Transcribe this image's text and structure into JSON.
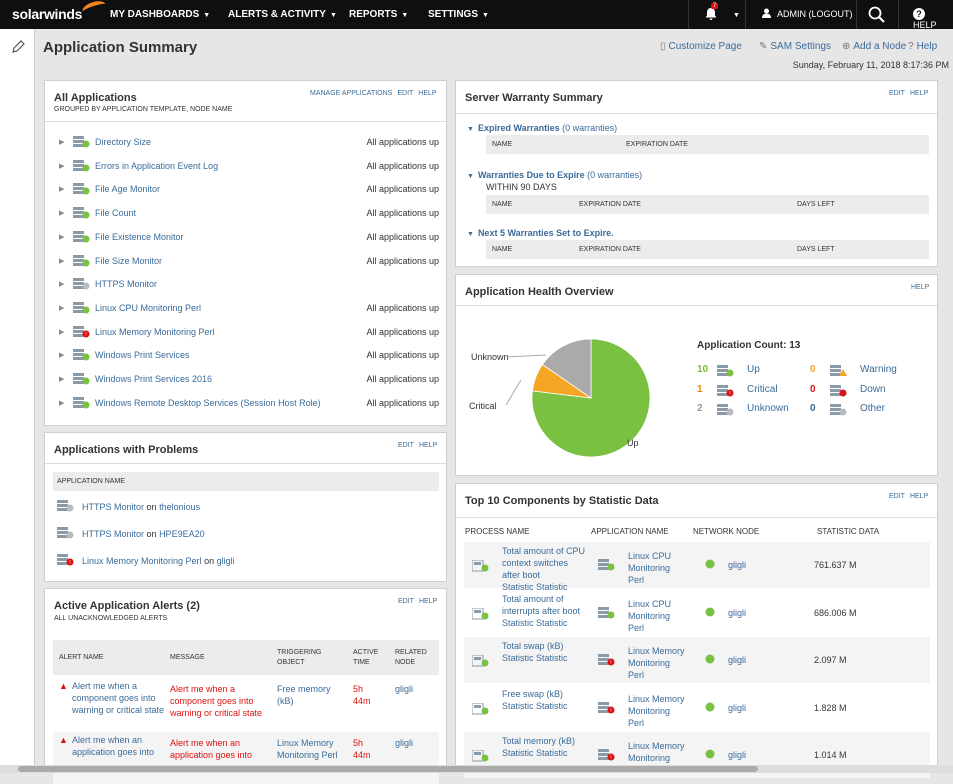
{
  "brand": "solarwinds",
  "nav": {
    "items": [
      "MY DASHBOARDS",
      "ALERTS & ACTIVITY",
      "REPORTS",
      "SETTINGS"
    ],
    "alert_count": "7",
    "user": "ADMIN (LOGOUT)",
    "help": "HELP"
  },
  "page": {
    "title": "Application Summary",
    "links": [
      "Customize Page",
      "SAM Settings",
      "Add a Node",
      "Help"
    ],
    "timestamp": "Sunday, February 11, 2018 8:17:36 PM"
  },
  "all_apps": {
    "title": "All Applications",
    "subtitle": "GROUPED BY APPLICATION TEMPLATE, NODE NAME",
    "links": [
      "MANAGE APPLICATIONS",
      "EDIT",
      "HELP"
    ],
    "rows": [
      {
        "name": "Directory Size",
        "status": "All applications up",
        "icon": "up"
      },
      {
        "name": "Errors in Application Event Log",
        "status": "All applications up",
        "icon": "up"
      },
      {
        "name": "File Age Monitor",
        "status": "All applications up",
        "icon": "up"
      },
      {
        "name": "File Count",
        "status": "All applications up",
        "icon": "up"
      },
      {
        "name": "File Existence Monitor",
        "status": "All applications up",
        "icon": "up"
      },
      {
        "name": "File Size Monitor",
        "status": "All applications up",
        "icon": "up"
      },
      {
        "name": "HTTPS Monitor",
        "status": "",
        "icon": "unknown"
      },
      {
        "name": "Linux CPU Monitoring Perl",
        "status": "All applications up",
        "icon": "up"
      },
      {
        "name": "Linux Memory Monitoring Perl",
        "status": "All applications up",
        "icon": "critical"
      },
      {
        "name": "Windows Print Services",
        "status": "All applications up",
        "icon": "up"
      },
      {
        "name": "Windows Print Services 2016",
        "status": "All applications up",
        "icon": "up"
      },
      {
        "name": "Windows Remote Desktop Services (Session Host Role)",
        "status": "All applications up",
        "icon": "up"
      }
    ]
  },
  "problems": {
    "title": "Applications with Problems",
    "links": [
      "EDIT",
      "HELP"
    ],
    "col": "APPLICATION NAME",
    "rows": [
      {
        "app": "HTTPS Monitor",
        "on": "on",
        "node": "thelonious",
        "icon": "unknown"
      },
      {
        "app": "HTTPS Monitor",
        "on": "on",
        "node": "HPE9EA20",
        "icon": "unknown"
      },
      {
        "app": "Linux Memory Monitoring Perl",
        "on": "on",
        "node": "gligli",
        "icon": "critical"
      }
    ]
  },
  "alerts": {
    "title": "Active Application Alerts (2)",
    "subtitle": "ALL UNACKNOWLEDGED ALERTS",
    "links": [
      "EDIT",
      "HELP"
    ],
    "cols": [
      "ALERT NAME",
      "MESSAGE",
      "TRIGGERING OBJECT",
      "ACTIVE TIME",
      "RELATED NODE"
    ],
    "rows": [
      {
        "name": "Alert me when a component goes into warning or critical state",
        "message": "Alert me when a component goes into warning or critical state",
        "object": "Free memory (kB)",
        "time": "5h 44m",
        "node": "gligli"
      },
      {
        "name": "Alert me when an application goes into",
        "message": "Alert me when an application goes into",
        "object": "Linux Memory Monitoring Perl",
        "time": "5h 44m",
        "node": "gligli"
      }
    ]
  },
  "warranty": {
    "title": "Server Warranty Summary",
    "links": [
      "EDIT",
      "HELP"
    ],
    "expired": {
      "label": "Expired Warranties",
      "count": "(0 warranties)",
      "cols": [
        "NAME",
        "EXPIRATION DATE"
      ]
    },
    "due": {
      "label": "Warranties Due to Expire",
      "count": "(0 warranties)",
      "within": "WITHIN 90 DAYS",
      "cols": [
        "NAME",
        "EXPIRATION DATE",
        "DAYS LEFT"
      ]
    },
    "next": {
      "label": "Next 5 Warranties Set to Expire.",
      "cols": [
        "NAME",
        "EXPIRATION DATE",
        "DAYS LEFT"
      ]
    }
  },
  "health": {
    "title": "Application Health Overview",
    "links": [
      "HELP"
    ],
    "count_label": "Application Count: 13",
    "legend": [
      {
        "count": "10",
        "label": "Up",
        "color": "#7abd30"
      },
      {
        "count": "0",
        "label": "Warning",
        "color": "#f5a623"
      },
      {
        "count": "1",
        "label": "Critical",
        "color": "#e8821a"
      },
      {
        "count": "0",
        "label": "Down",
        "color": "#d11"
      },
      {
        "count": "2",
        "label": "Unknown",
        "color": "#999"
      },
      {
        "count": "0",
        "label": "Other",
        "color": "#3a6b9a"
      }
    ],
    "pie_labels": {
      "unknown": "Unknown",
      "critical": "Critical",
      "up": "Up"
    }
  },
  "chart_data": {
    "type": "pie",
    "categories": [
      "Up",
      "Critical",
      "Unknown"
    ],
    "values": [
      10,
      1,
      2
    ],
    "colors": [
      "#7ac142",
      "#f5a623",
      "#aaaaaa"
    ]
  },
  "top10": {
    "title": "Top 10 Components by Statistic Data",
    "links": [
      "EDIT",
      "HELP"
    ],
    "cols": [
      "PROCESS NAME",
      "APPLICATION NAME",
      "NETWORK NODE",
      "STATISTIC DATA"
    ],
    "rows": [
      {
        "process": "Total amount of CPU context switches after boot",
        "stat_label": "Statistic Statistic",
        "app": "Linux CPU Monitoring Perl",
        "node": "gligli",
        "value": "761.637 M",
        "icon": "up"
      },
      {
        "process": "Total amount of interrupts after boot",
        "stat_label": "Statistic Statistic",
        "app": "Linux CPU Monitoring Perl",
        "node": "gligli",
        "value": "686.006 M",
        "icon": "up"
      },
      {
        "process": "Total swap (kB)",
        "stat_label": "Statistic Statistic",
        "app": "Linux Memory Monitoring Perl",
        "node": "gligli",
        "value": "2.097 M",
        "icon": "critical"
      },
      {
        "process": "Free swap (kB)",
        "stat_label": "Statistic Statistic",
        "app": "Linux Memory Monitoring Perl",
        "node": "gligli",
        "value": "1.828 M",
        "icon": "critical"
      },
      {
        "process": "Total memory (kB)",
        "stat_label": "Statistic Statistic",
        "app": "Linux Memory Monitoring Perl",
        "node": "gligli",
        "value": "1.014 M",
        "icon": "critical"
      }
    ]
  }
}
